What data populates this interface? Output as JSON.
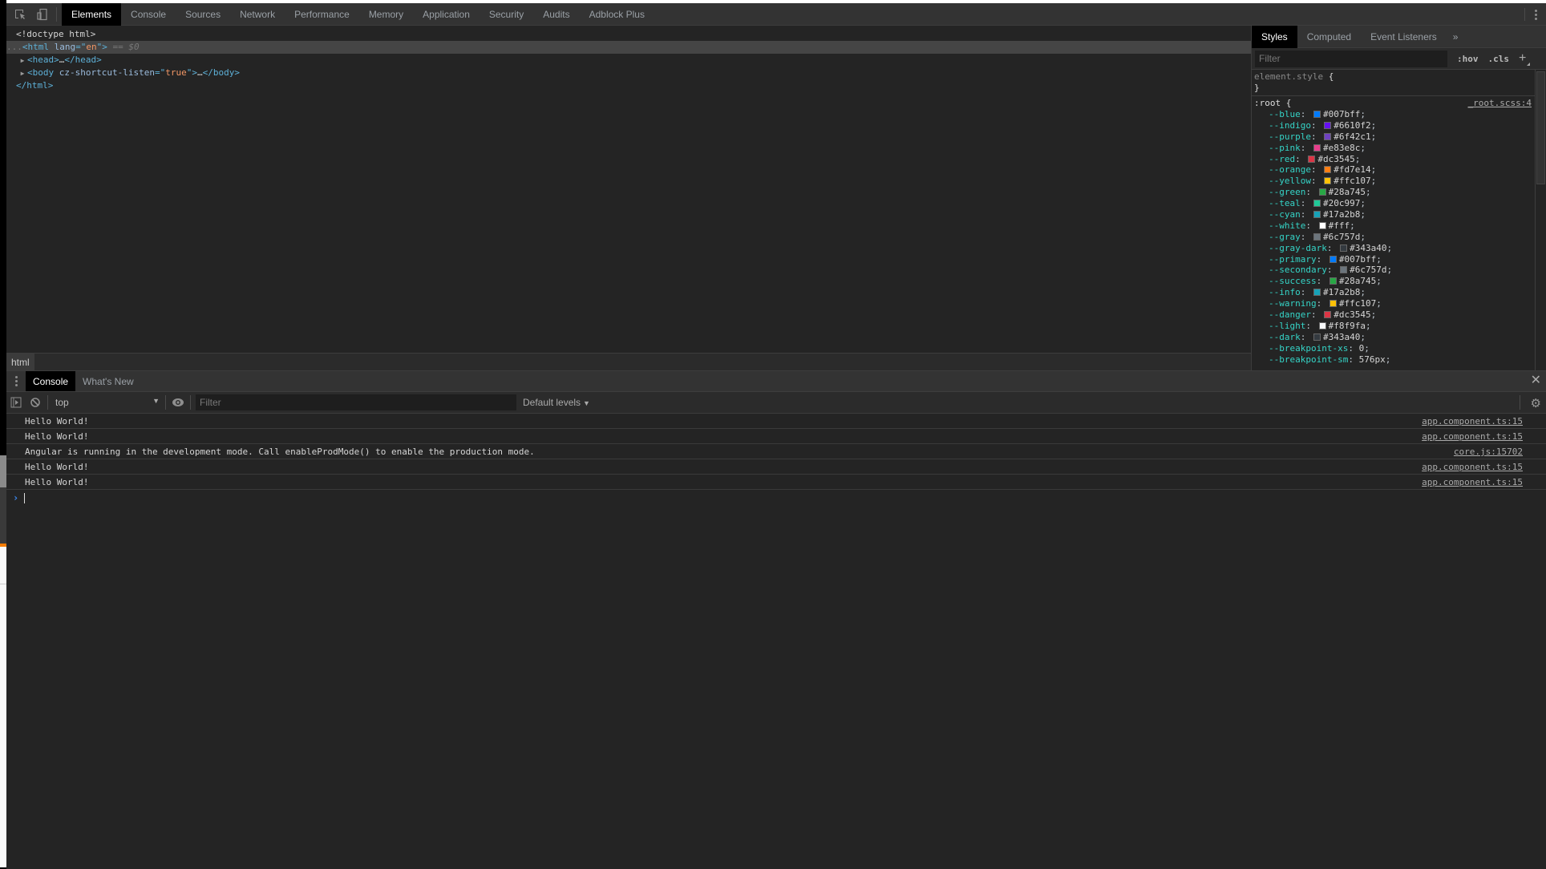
{
  "main_tabs": [
    "Elements",
    "Console",
    "Sources",
    "Network",
    "Performance",
    "Memory",
    "Application",
    "Security",
    "Audits",
    "Adblock Plus"
  ],
  "main_tabs_active": "Elements",
  "dom": {
    "doctype": "<!doctype html>",
    "html_open_tag": "html",
    "html_attr_name": "lang",
    "html_attr_value": "en",
    "selected_ref": "== $0",
    "head_tag": "head",
    "body_tag": "body",
    "body_attr_name": "cz-shortcut-listen",
    "body_attr_value": "true",
    "html_close": "</html>",
    "ellipsis": "…"
  },
  "breadcrumb": [
    "html"
  ],
  "styles": {
    "tabs": [
      "Styles",
      "Computed",
      "Event Listeners"
    ],
    "more_label": "»",
    "filter_placeholder": "Filter",
    "hov_label": ":hov",
    "cls_label": ".cls",
    "add_label": "+",
    "element_style_selector": "element.style",
    "root_selector": ":root",
    "root_source": "_root.scss:4",
    "root_props": [
      {
        "name": "--blue",
        "value": "#007bff",
        "swatch": "#007bff"
      },
      {
        "name": "--indigo",
        "value": "#6610f2",
        "swatch": "#6610f2"
      },
      {
        "name": "--purple",
        "value": "#6f42c1",
        "swatch": "#6f42c1"
      },
      {
        "name": "--pink",
        "value": "#e83e8c",
        "swatch": "#e83e8c"
      },
      {
        "name": "--red",
        "value": "#dc3545",
        "swatch": "#dc3545"
      },
      {
        "name": "--orange",
        "value": "#fd7e14",
        "swatch": "#fd7e14"
      },
      {
        "name": "--yellow",
        "value": "#ffc107",
        "swatch": "#ffc107"
      },
      {
        "name": "--green",
        "value": "#28a745",
        "swatch": "#28a745"
      },
      {
        "name": "--teal",
        "value": "#20c997",
        "swatch": "#20c997"
      },
      {
        "name": "--cyan",
        "value": "#17a2b8",
        "swatch": "#17a2b8"
      },
      {
        "name": "--white",
        "value": "#fff",
        "swatch": "#ffffff"
      },
      {
        "name": "--gray",
        "value": "#6c757d",
        "swatch": "#6c757d"
      },
      {
        "name": "--gray-dark",
        "value": "#343a40",
        "swatch": "#343a40"
      },
      {
        "name": "--primary",
        "value": "#007bff",
        "swatch": "#007bff"
      },
      {
        "name": "--secondary",
        "value": "#6c757d",
        "swatch": "#6c757d"
      },
      {
        "name": "--success",
        "value": "#28a745",
        "swatch": "#28a745"
      },
      {
        "name": "--info",
        "value": "#17a2b8",
        "swatch": "#17a2b8"
      },
      {
        "name": "--warning",
        "value": "#ffc107",
        "swatch": "#ffc107"
      },
      {
        "name": "--danger",
        "value": "#dc3545",
        "swatch": "#dc3545"
      },
      {
        "name": "--light",
        "value": "#f8f9fa",
        "swatch": "#f8f9fa"
      },
      {
        "name": "--dark",
        "value": "#343a40",
        "swatch": "#343a40"
      },
      {
        "name": "--breakpoint-xs",
        "value": "0",
        "swatch": null
      },
      {
        "name": "--breakpoint-sm",
        "value": "576px",
        "swatch": null
      }
    ]
  },
  "drawer": {
    "tabs": [
      "Console",
      "What's New"
    ],
    "active_tab": "Console",
    "context": "top",
    "filter_placeholder": "Filter",
    "levels": "Default levels",
    "messages": [
      {
        "text": "Hello World!",
        "source": "app.component.ts:15"
      },
      {
        "text": "Hello World!",
        "source": "app.component.ts:15"
      },
      {
        "text": "Angular is running in the development mode. Call enableProdMode() to enable the production mode.",
        "source": "core.js:15702"
      },
      {
        "text": "Hello World!",
        "source": "app.component.ts:15"
      },
      {
        "text": "Hello World!",
        "source": "app.component.ts:15"
      }
    ],
    "prompt_symbol": "›"
  },
  "icons": {
    "close": "✕",
    "gear": "⚙",
    "dropdown_arrow": "▼",
    "expand_triangle": "▶"
  }
}
